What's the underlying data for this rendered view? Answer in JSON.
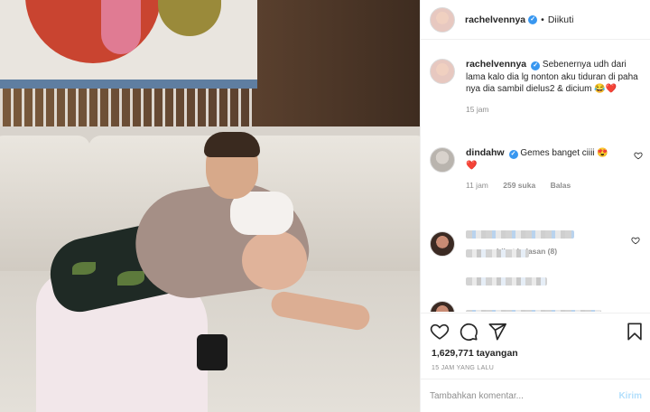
{
  "header": {
    "username": "rachelvennya",
    "follow_sep": "•",
    "follow_status": "Diikuti"
  },
  "caption": {
    "username": "rachelvennya",
    "text": "Sebenernya udh dari lama kalo dia lg nonton aku tiduran di paha nya dia sambil dielus2 & dicium",
    "emoji": "😂❤️",
    "time": "15 jam"
  },
  "comment": {
    "username": "dindahw",
    "text": "Gemes banget ciiii 😍",
    "emoji2": "❤️",
    "time": "11 jam",
    "likes": "259 suka",
    "reply": "Balas",
    "view_replies": "Lihat balasan (8)"
  },
  "stats": {
    "views": "1,629,771 tayangan",
    "posted": "15 JAM YANG LALU"
  },
  "add_comment": {
    "placeholder": "Tambahkan komentar...",
    "post_label": "Kirim"
  },
  "colors": {
    "verified": "#3897f0",
    "muted": "#8e8e8e",
    "post_disabled": "#b2dffc"
  },
  "icons": [
    "heart-icon",
    "comment-icon",
    "share-icon",
    "bookmark-icon"
  ]
}
